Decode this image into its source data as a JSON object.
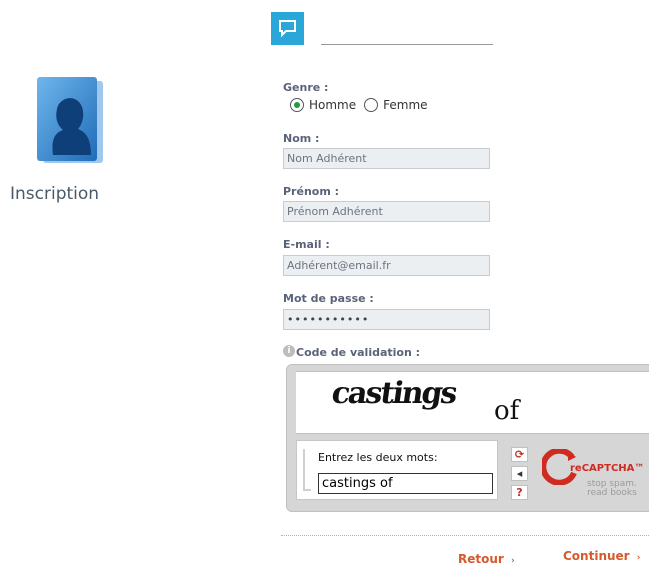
{
  "sidebar": {
    "title": "Inscription"
  },
  "form": {
    "genre_label": "Genre :",
    "genre_options": [
      "Homme",
      "Femme"
    ],
    "genre_selected": "Homme",
    "nom_label": "Nom :",
    "nom_value": "Nom Adhérent",
    "prenom_label": "Prénom :",
    "prenom_value": "Prénom Adhérent",
    "email_label": "E-mail :",
    "email_value": "Adhérent@email.fr",
    "password_label": "Mot de passe :",
    "password_value": "•••••••••••",
    "validation_label": "Code de validation :"
  },
  "captcha": {
    "word1": "castings",
    "word2": "of",
    "instruction": "Entrez les deux mots:",
    "input_value": "castings of",
    "brand": "reCAPTCHA™",
    "tagline_1": "stop spam.",
    "tagline_2": "read books"
  },
  "footer": {
    "back_label": "Retour",
    "continue_label": "Continuer"
  },
  "colors": {
    "accent": "#d65a2c",
    "label": "#5a6378",
    "radio_selected": "#1f9a45"
  }
}
